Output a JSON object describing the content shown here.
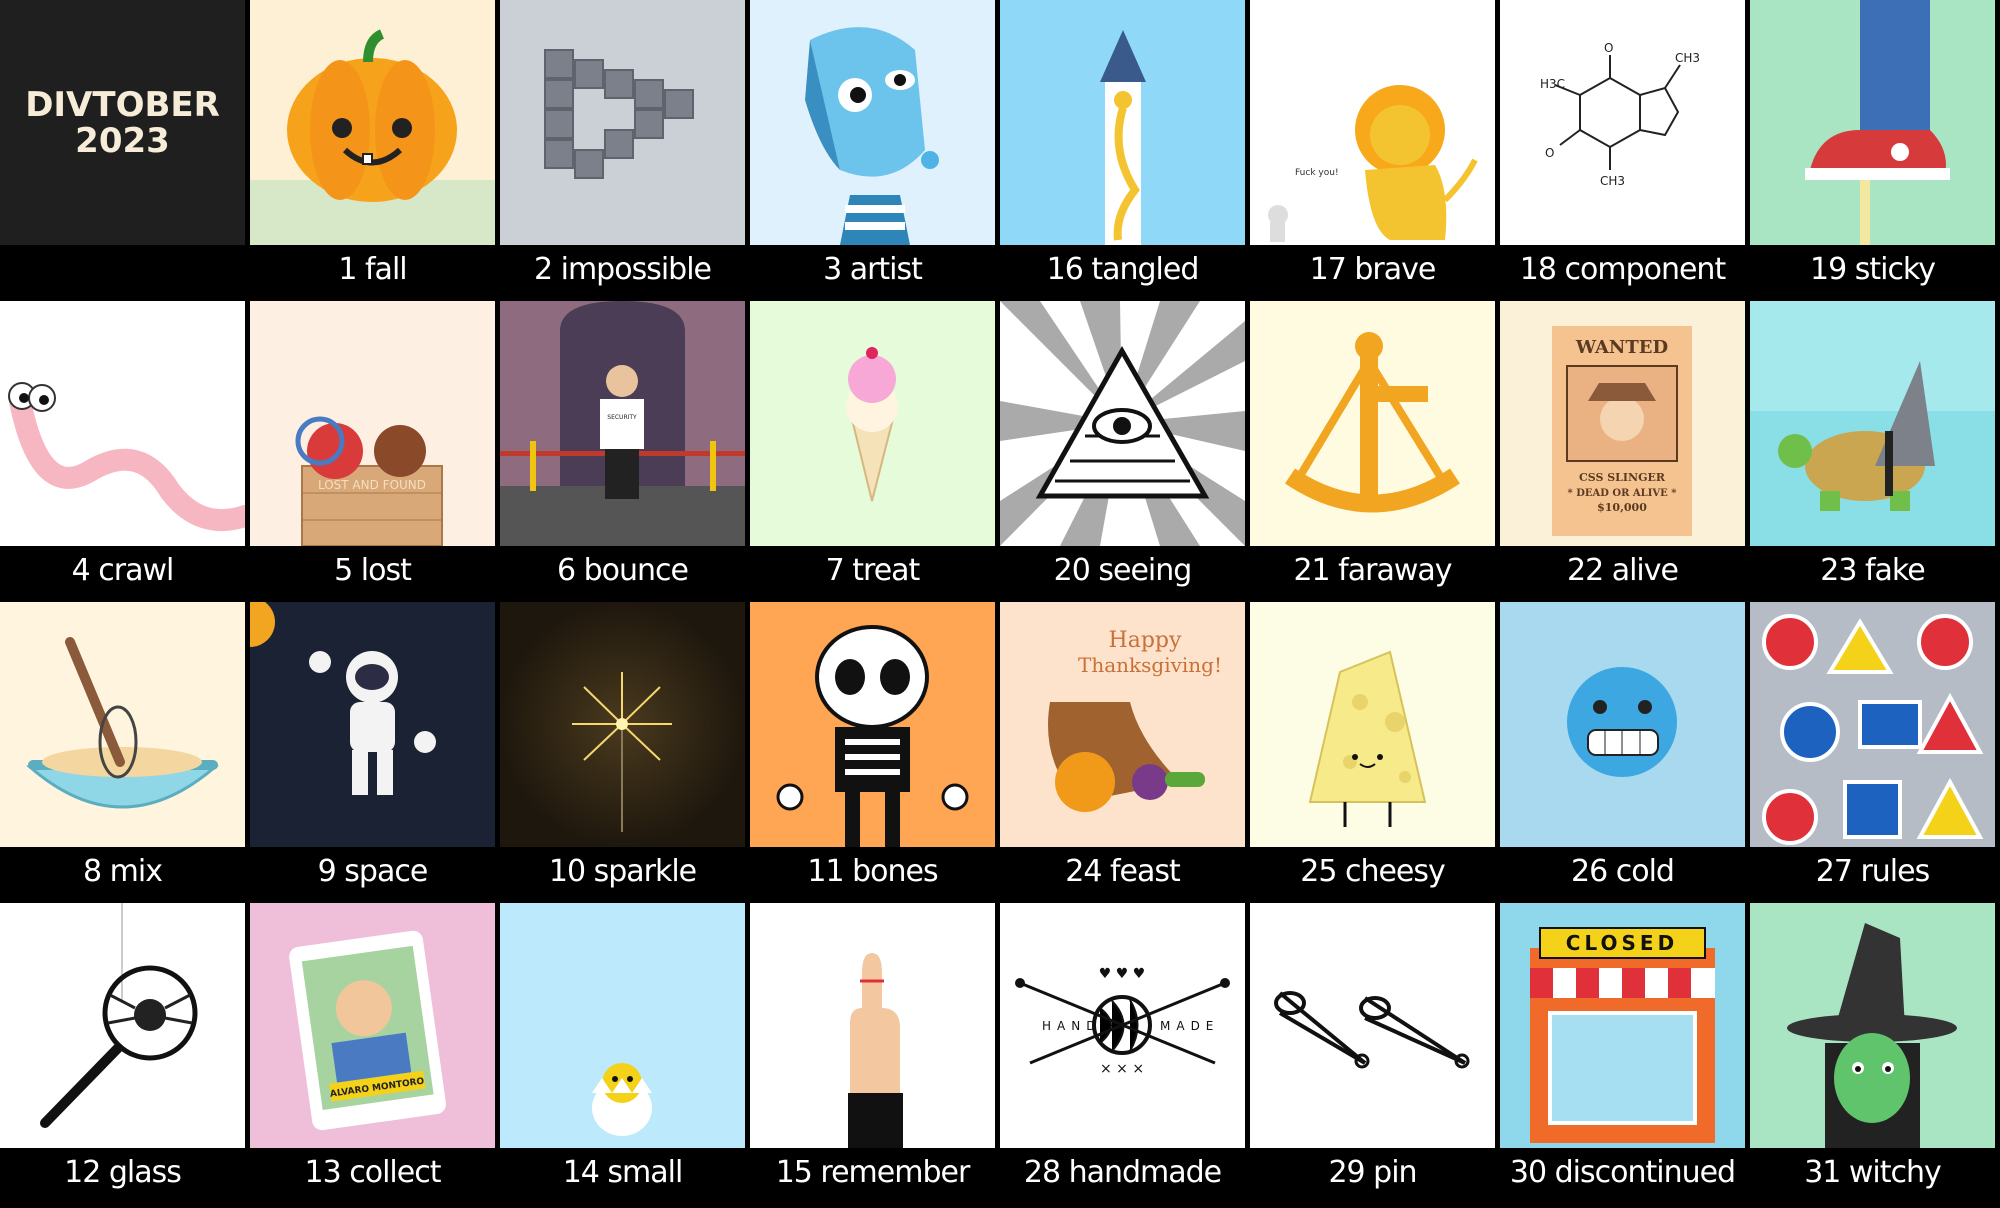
{
  "header": {
    "title_line1": "DIVTOBER",
    "title_line2": "2023"
  },
  "tiles": [
    {
      "label": "1 fall",
      "slug": "fall",
      "bg": "#fdf0d5",
      "icon": "pumpkin-icon"
    },
    {
      "label": "2 impossible",
      "slug": "impossible",
      "bg": "#cbcfd6",
      "icon": "impossible-triangle-icon"
    },
    {
      "label": "3 artist",
      "slug": "artist",
      "bg": "#dff1fc",
      "icon": "cubist-portrait-icon"
    },
    {
      "label": "16 tangled",
      "slug": "tangled",
      "bg": "#8fd8f8",
      "icon": "tower-icon"
    },
    {
      "label": "17 brave",
      "slug": "brave",
      "bg": "#ffffff",
      "icon": "lion-icon",
      "text": "Fuck you!"
    },
    {
      "label": "18 component",
      "slug": "component",
      "bg": "#ffffff",
      "icon": "caffeine-molecule-icon"
    },
    {
      "label": "19 sticky",
      "slug": "sticky",
      "bg": "#a9e4c3",
      "icon": "sneaker-icon"
    },
    {
      "label": "4 crawl",
      "slug": "crawl",
      "bg": "#ffffff",
      "icon": "worm-icon"
    },
    {
      "label": "5 lost",
      "slug": "lost",
      "bg": "#fdf0e3",
      "icon": "lost-and-found-box-icon",
      "text": "LOST AND FOUND"
    },
    {
      "label": "6 bounce",
      "slug": "bounce",
      "bg": "#8f6b80",
      "icon": "bouncer-icon",
      "text": "SECURITY"
    },
    {
      "label": "7 treat",
      "slug": "treat",
      "bg": "#e5fbd9",
      "icon": "ice-cream-icon"
    },
    {
      "label": "20 seeing",
      "slug": "seeing",
      "bg": "#ffffff",
      "icon": "all-seeing-eye-icon"
    },
    {
      "label": "21 faraway",
      "slug": "faraway",
      "bg": "#fffbe0",
      "icon": "sextant-icon"
    },
    {
      "label": "22 alive",
      "slug": "alive",
      "bg": "#fbf1d9",
      "icon": "wanted-poster-icon",
      "text": "WANTED",
      "text2": "CSS SLINGER",
      "text3": "* DEAD OR ALIVE *",
      "text4": "$10,000"
    },
    {
      "label": "23 fake",
      "slug": "fake",
      "bg": "#a6e9ec",
      "icon": "turtle-shark-fin-icon"
    },
    {
      "label": "8 mix",
      "slug": "mix",
      "bg": "#fff4dd",
      "icon": "whisk-bowl-icon"
    },
    {
      "label": "9 space",
      "slug": "space",
      "bg": "#1b2233",
      "icon": "astronaut-icon"
    },
    {
      "label": "10 sparkle",
      "slug": "sparkle",
      "bg": "#2a2014",
      "icon": "sparkler-icon"
    },
    {
      "label": "11 bones",
      "slug": "bones",
      "bg": "#ffa655",
      "icon": "skeleton-icon"
    },
    {
      "label": "24 feast",
      "slug": "feast",
      "bg": "#fde3cb",
      "icon": "cornucopia-icon",
      "text": "Happy",
      "text2": "Thanksgiving!"
    },
    {
      "label": "25 cheesy",
      "slug": "cheesy",
      "bg": "#fdfde5",
      "icon": "cheese-icon"
    },
    {
      "label": "26 cold",
      "slug": "cold",
      "bg": "#a8d9ee",
      "icon": "freezing-face-icon"
    },
    {
      "label": "27 rules",
      "slug": "rules",
      "bg": "#b6bcc6",
      "icon": "road-signs-icon"
    },
    {
      "label": "12 glass",
      "slug": "glass",
      "bg": "#ffffff",
      "icon": "magnifying-glass-spider-icon"
    },
    {
      "label": "13 collect",
      "slug": "collect",
      "bg": "#efbfd9",
      "icon": "trading-card-icon",
      "text": "ALVARO MONTORO"
    },
    {
      "label": "14 small",
      "slug": "small",
      "bg": "#bce9fb",
      "icon": "hatching-chick-icon"
    },
    {
      "label": "15 remember",
      "slug": "remember",
      "bg": "#ffffff",
      "icon": "finger-string-icon"
    },
    {
      "label": "28 handmade",
      "slug": "handmade",
      "bg": "#ffffff",
      "icon": "yarn-needles-icon",
      "text": "HAND",
      "text2": "MADE"
    },
    {
      "label": "29 pin",
      "slug": "pin",
      "bg": "#ffffff",
      "icon": "safety-pins-icon"
    },
    {
      "label": "30 discontinued",
      "slug": "discontinued",
      "bg": "#8fd8ec",
      "icon": "closed-store-icon",
      "text": "CLOSED"
    },
    {
      "label": "31 witchy",
      "slug": "witchy",
      "bg": "#a9e4c3",
      "icon": "witch-icon"
    }
  ]
}
